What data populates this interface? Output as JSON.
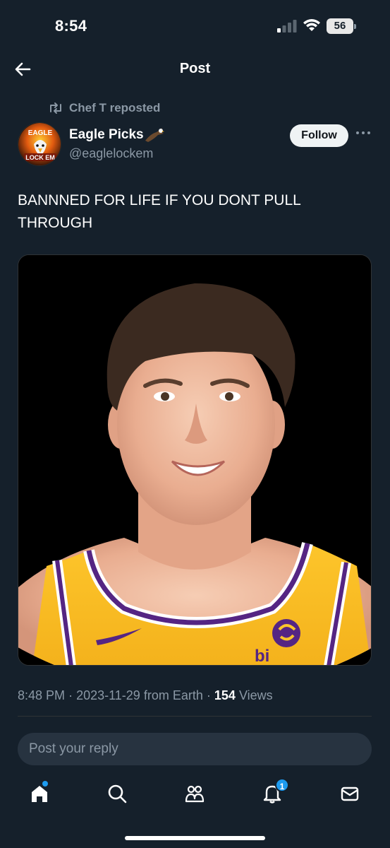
{
  "status_bar": {
    "time": "8:54",
    "battery": "56"
  },
  "header": {
    "title": "Post"
  },
  "repost": {
    "label": "Chef T reposted"
  },
  "author": {
    "name": "Eagle Picks",
    "handle": "@eaglelockem",
    "avatar_text_top": "EAGLE",
    "avatar_text_bottom": "LOCK EM"
  },
  "follow_button": {
    "label": "Follow"
  },
  "post": {
    "text": "BANNNED FOR LIFE IF YOU DONT PULL THROUGH"
  },
  "media": {
    "jersey_text": "bi"
  },
  "meta": {
    "time": "8:48 PM",
    "date": "2023-11-29",
    "source": "from Earth",
    "views_count": "154",
    "views_label": "Views",
    "separator": "·"
  },
  "reply": {
    "placeholder": "Post your reply"
  },
  "tab_bar": {
    "items": [
      {
        "name": "home",
        "icon": "home-icon"
      },
      {
        "name": "search",
        "icon": "search-icon"
      },
      {
        "name": "communities",
        "icon": "communities-icon"
      },
      {
        "name": "notifications",
        "icon": "bell-icon",
        "badge": "1"
      },
      {
        "name": "messages",
        "icon": "mail-icon"
      }
    ]
  },
  "colors": {
    "background": "#15202b",
    "accent": "#1d9bf0",
    "secondary_text": "#8b98a5",
    "jersey_yellow": "#fdb927",
    "jersey_purple": "#552583"
  }
}
